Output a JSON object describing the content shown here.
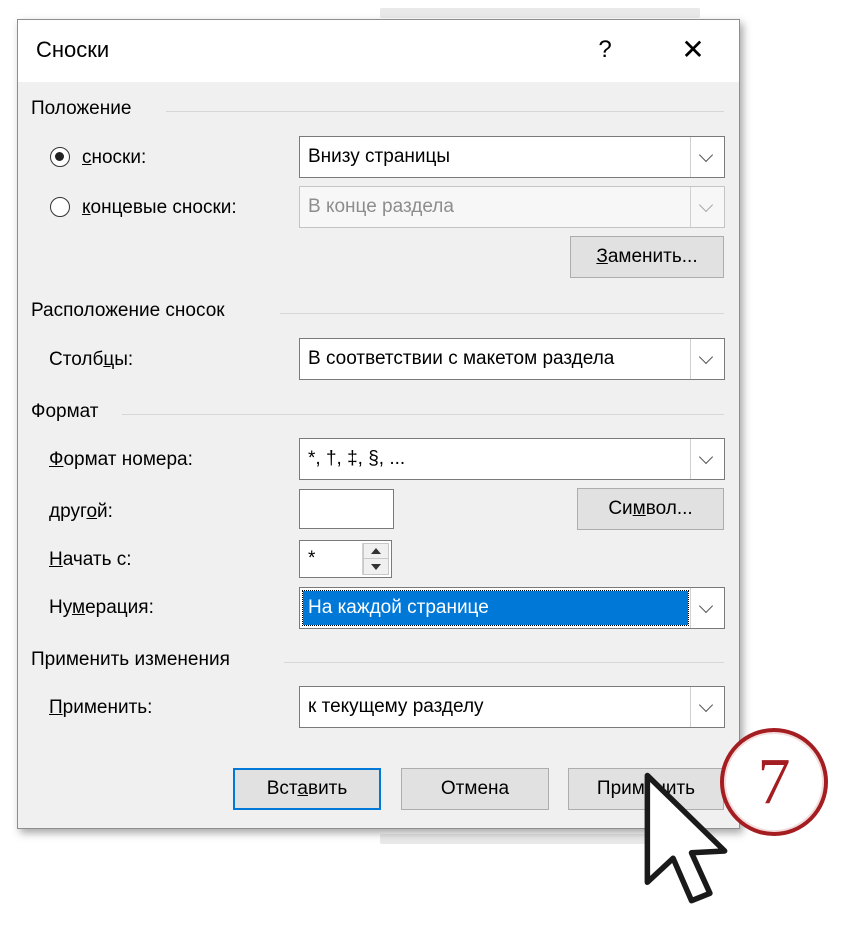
{
  "dialog": {
    "title": "Сноски",
    "help_glyph": "?",
    "close_glyph": "✕"
  },
  "position": {
    "section_label": "Положение",
    "footnotes": {
      "label_underlined": "с",
      "label_rest": "носки:",
      "checked": true,
      "value": "Внизу страницы"
    },
    "endnotes": {
      "label_pre": "",
      "label_underlined": "к",
      "label_rest": "онцевые сноски:",
      "checked": false,
      "value": "В конце раздела"
    },
    "convert_pre": "",
    "convert_underlined": "З",
    "convert_rest": "аменить..."
  },
  "layout": {
    "section_label": "Расположение сносок",
    "columns_pre": "Столб",
    "columns_underlined": "ц",
    "columns_rest": "ы:",
    "columns_value": "В соответствии с макетом раздела"
  },
  "format": {
    "section_label": "Формат",
    "number_format_pre": "",
    "number_format_underlined": "Ф",
    "number_format_rest": "ормат номера:",
    "number_format_value": "*, †, ‡, §, ...",
    "custom_pre": "друг",
    "custom_underlined": "о",
    "custom_rest": "й:",
    "custom_value": "",
    "symbol_pre": "Си",
    "symbol_underlined": "м",
    "symbol_rest": "вол...",
    "start_at_pre": "",
    "start_at_underlined": "Н",
    "start_at_rest": "ачать с:",
    "start_at_value": "*",
    "numbering_pre": "Ну",
    "numbering_underlined": "м",
    "numbering_rest": "ерация:",
    "numbering_value": "На каждой странице"
  },
  "apply_changes": {
    "section_label": "Применить изменения",
    "apply_to_pre": "",
    "apply_to_underlined": "П",
    "apply_to_rest": "рименить:",
    "apply_to_value": "к текущему разделу"
  },
  "buttons": {
    "insert_pre": "Вст",
    "insert_underlined": "а",
    "insert_rest": "вить",
    "cancel": "Отмена",
    "apply": "Применить"
  },
  "step_badge": "7"
}
